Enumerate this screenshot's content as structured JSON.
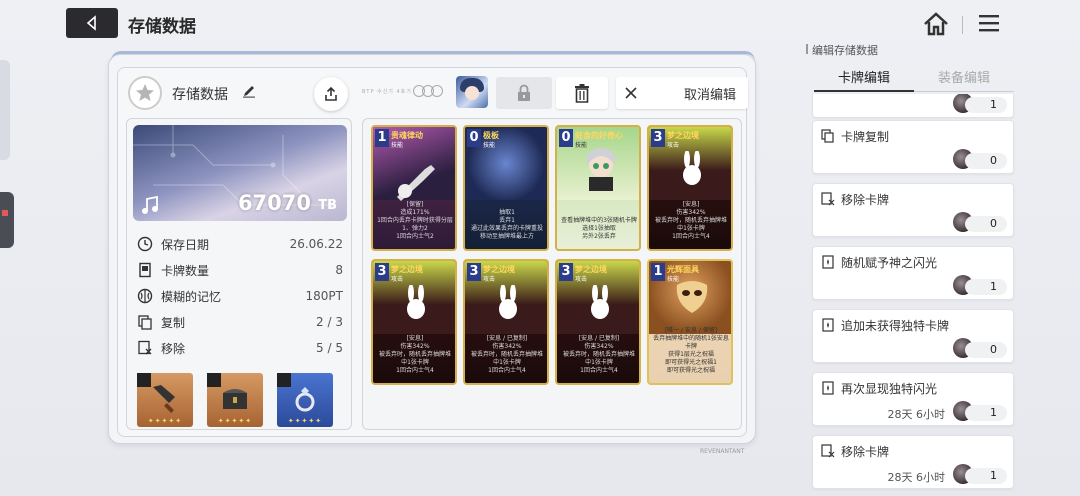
{
  "header": {
    "title": "存储数据"
  },
  "panel": {
    "title": "存储数据",
    "tiny_text": "BTP 수신기 4호기",
    "cancel_label": "取消编辑"
  },
  "data_info": {
    "value": "67070",
    "unit": "TB",
    "stats": [
      {
        "label": "保存日期",
        "value": "26.06.22",
        "icon": "clock-icon"
      },
      {
        "label": "卡牌数量",
        "value": "8",
        "icon": "card-icon"
      },
      {
        "label": "模糊的记忆",
        "value": "180PT",
        "icon": "brain-icon"
      },
      {
        "label": "复制",
        "value": "2 / 3",
        "icon": "copy-icon"
      },
      {
        "label": "移除",
        "value": "5 / 5",
        "icon": "remove-icon"
      }
    ],
    "equipment": [
      {
        "name": "cleaver-icon",
        "stars": "✦✦✦✦✦",
        "color": "#c9874e"
      },
      {
        "name": "chest-icon",
        "stars": "✦✦✦✦✦",
        "color": "#c9874e"
      },
      {
        "name": "ring-icon",
        "stars": "✦✦✦✦✦",
        "color": "#3b5fbf"
      }
    ]
  },
  "cards": [
    {
      "cost": "1",
      "name": "贵魂律动",
      "type": "技能",
      "desc": "[保留]\n造成171%\n1回合内丢弃卡牌时获得分层1、弹力2\n1回合内士气2"
    },
    {
      "cost": "0",
      "name": "极板",
      "type": "技能",
      "desc": "抽取1\n丢弃1\n通过此效果丢弃的卡牌重投移动至抽牌堆最上方"
    },
    {
      "cost": "0",
      "name": "蛀食的好奇心",
      "type": "技能",
      "desc": "查看抽牌堆中的3张随机卡牌\n选择1张抽取\n另外2张丢弃"
    },
    {
      "cost": "3",
      "name": "梦之边境",
      "type": "攻击",
      "desc": "[安息]\n伤害342%\n被丢弃时，随机丢弃抽牌堆中1张卡牌\n1回合内士气4"
    },
    {
      "cost": "3",
      "name": "梦之边境",
      "type": "攻击",
      "desc": "[安息]\n伤害342%\n被丢弃时，随机丢弃抽牌堆中1张卡牌\n1回合内士气4"
    },
    {
      "cost": "3",
      "name": "梦之边境",
      "type": "攻击",
      "desc": "[安息 / 已复制]\n伤害342%\n被丢弃时，随机丢弃抽牌堆中1张卡牌\n1回合内士气4"
    },
    {
      "cost": "3",
      "name": "梦之边境",
      "type": "攻击",
      "desc": "[安息 / 已复制]\n伤害342%\n被丢弃时，随机丢弃抽牌堆中1张卡牌\n1回合内士气4"
    },
    {
      "cost": "1",
      "name": "光辉面具",
      "type": "技能",
      "desc": "[唯一 / 安息 / 保留]\n丢弃抽牌堆中的随机1张安息卡牌\n获得1层光之祝福\n即可获得光之祝福1\n即可获得光之祝福"
    }
  ],
  "right": {
    "heading": "编辑存储数据",
    "tab_active": "卡牌编辑",
    "tab_inactive": "装备编辑",
    "items": [
      {
        "title": "",
        "cooldown": "",
        "count": "1",
        "partial": true
      },
      {
        "title": "卡牌复制",
        "cooldown": "",
        "count": "0"
      },
      {
        "title": "移除卡牌",
        "cooldown": "",
        "count": "0"
      },
      {
        "title": "随机赋予神之闪光",
        "cooldown": "",
        "count": "1"
      },
      {
        "title": "追加未获得独特卡牌",
        "cooldown": "",
        "count": "0"
      },
      {
        "title": "再次显现独特闪光",
        "cooldown": "28天 6小时",
        "count": "1"
      },
      {
        "title": "移除卡牌",
        "cooldown": "28天 6小时",
        "count": "1"
      }
    ]
  },
  "footer": {
    "right_text": "REVENANTANT"
  },
  "colors": {
    "accent": "#2b2b2f",
    "card_border": "#c9a64a",
    "stars": "#f5d77a"
  }
}
